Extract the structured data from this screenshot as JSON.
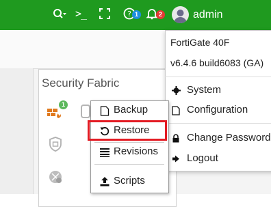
{
  "topbar": {
    "cli_glyph": ">_",
    "help_badge": "1",
    "alerts_badge": "2",
    "username": "admin",
    "bg_color": "#1f9a1f"
  },
  "panel": {
    "title": "Security Fabric",
    "badge": "1"
  },
  "user_menu": {
    "device_name": "FortiGate 40F",
    "version": "v6.4.6 build6083 (GA)",
    "items": [
      {
        "label": "System",
        "icon": "gear-icon"
      },
      {
        "label": "Configuration",
        "icon": "file-icon"
      },
      {
        "label": "Change Password",
        "icon": "lock-icon"
      },
      {
        "label": "Logout",
        "icon": "logout-icon"
      }
    ]
  },
  "config_menu": {
    "items": [
      {
        "label": "Backup",
        "icon": "file-icon"
      },
      {
        "label": "Restore",
        "icon": "restore-icon"
      },
      {
        "label": "Revisions",
        "icon": "list-icon"
      },
      {
        "label": "Scripts",
        "icon": "upload-icon"
      }
    ],
    "highlight_color": "#e31b23"
  }
}
